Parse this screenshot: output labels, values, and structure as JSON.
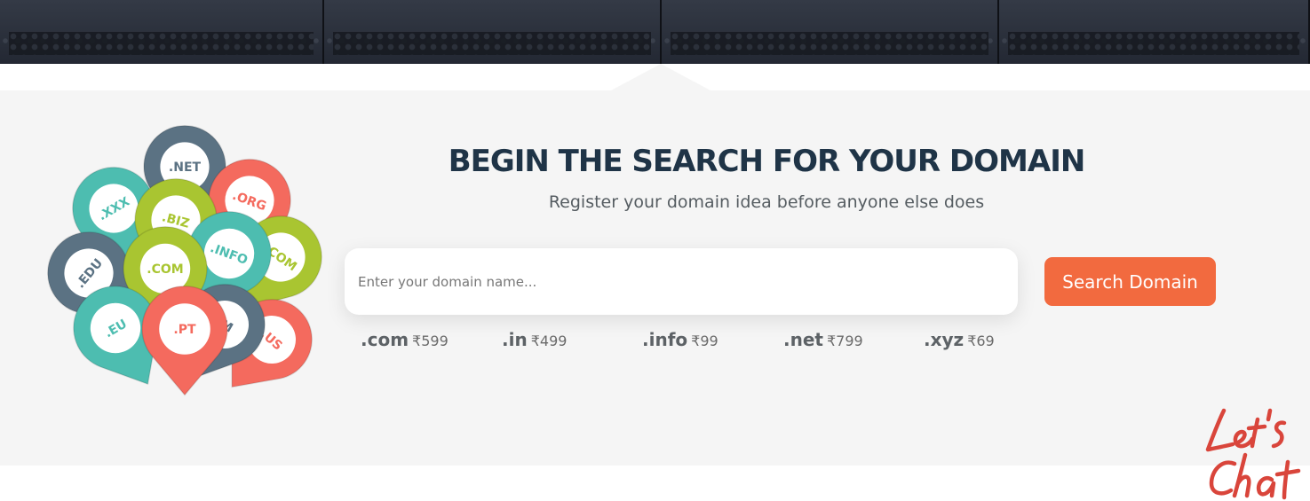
{
  "search_section": {
    "title": "BEGIN THE SEARCH FOR YOUR DOMAIN",
    "subtitle": "Register your domain idea before anyone else does",
    "input_placeholder": "Enter your domain name...",
    "input_value": "",
    "button_label": "Search Domain"
  },
  "prices": [
    {
      "ext": ".com",
      "amount": "₹599"
    },
    {
      "ext": ".in",
      "amount": "₹499"
    },
    {
      "ext": ".info",
      "amount": "₹99"
    },
    {
      "ext": ".net",
      "amount": "₹799"
    },
    {
      "ext": ".xyz",
      "amount": "₹69"
    }
  ],
  "balloons": [
    {
      "label": ".NET",
      "color": "#5b7283"
    },
    {
      "label": ".XXX",
      "color": "#4dbdb0"
    },
    {
      "label": ".ORG",
      "color": "#f46a5e"
    },
    {
      "label": ".BIZ",
      "color": "#a9c531"
    },
    {
      "label": ".COM",
      "color": "#a9c531"
    },
    {
      "label": ".INFO",
      "color": "#4dbdb0"
    },
    {
      "label": ".EDU",
      "color": "#5b7283"
    },
    {
      "label": ".COM",
      "color": "#a9c531"
    },
    {
      "label": ".US",
      "color": "#f46a5e"
    },
    {
      "label": ".M",
      "color": "#5b7283"
    },
    {
      "label": ".EU",
      "color": "#4dbdb0"
    },
    {
      "label": ".PT",
      "color": "#f46a5e"
    }
  ],
  "chat_widget": {
    "label": "Let's Chat",
    "color": "#d9453b"
  },
  "colors": {
    "accent": "#f26a3f",
    "heading": "#1f3447",
    "panel": "#f5f5f5"
  }
}
